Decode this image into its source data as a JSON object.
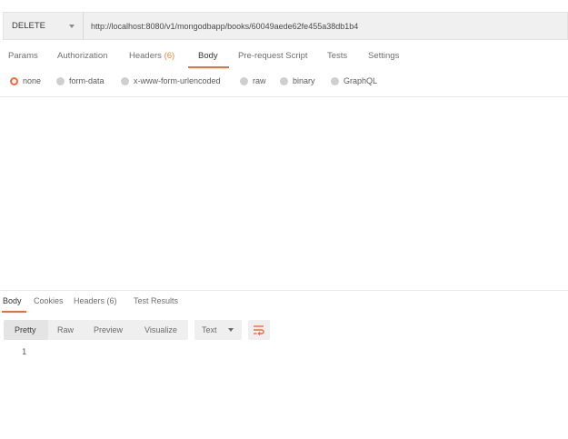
{
  "request": {
    "method": "DELETE",
    "url": "http://localhost:8080/v1/mongodbapp/books/60049aede62fe455a38db1b4"
  },
  "request_tabs": {
    "params": "Params",
    "authorization": "Authorization",
    "headers": "Headers",
    "headers_count": "(6)",
    "body": "Body",
    "prerequest": "Pre-request Script",
    "tests": "Tests",
    "settings": "Settings",
    "active": "Body"
  },
  "body_types": {
    "none": "none",
    "form_data": "form-data",
    "urlencoded": "x-www-form-urlencoded",
    "raw": "raw",
    "binary": "binary",
    "graphql": "GraphQL",
    "selected": "none"
  },
  "response_tabs": {
    "body": "Body",
    "cookies": "Cookies",
    "headers": "Headers (6)",
    "test_results": "Test Results",
    "active": "Body"
  },
  "response_toolbar": {
    "pretty": "Pretty",
    "raw": "Raw",
    "preview": "Preview",
    "visualize": "Visualize",
    "active": "Pretty",
    "language": "Text",
    "wrap_icon": "wrap-lines-icon"
  },
  "response_body": {
    "line_number": "1"
  },
  "colors": {
    "accent": "#f26b3a",
    "count": "#e2883f",
    "toolbar_bg": "#efefef"
  }
}
